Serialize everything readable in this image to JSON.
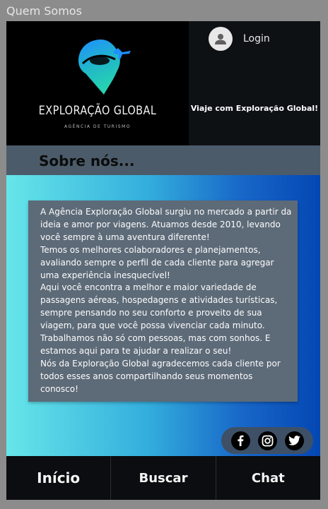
{
  "window": {
    "title": "Quem Somos"
  },
  "header": {
    "logo_title": "EXPLORAÇÃO GLOBAL",
    "logo_subtitle": "AGÊNCIA DE TURISMO",
    "login_label": "Login",
    "tagline": "Viaje com Exploração Global!"
  },
  "about": {
    "title": "Sobre nós...",
    "paragraphs": [
      "A Agência Exploração Global surgiu no mercado a partir da ideia e amor por viagens. Atuamos desde 2010, levando você sempre à uma aventura diferente!",
      "Temos os melhores colaboradores e planejamentos, avaliando sempre o perfil de cada cliente para agregar uma experiência inesquecível!",
      "Aqui você encontra a melhor e maior variedade de passagens aéreas, hospedagens e atividades turísticas, sempre pensando no seu conforto e proveito de sua viagem, para que você possa vivenciar cada minuto.",
      "Trabalhamos não só com pessoas, mas com sonhos. E estamos aqui para te ajudar a realizar o seu!",
      "Nós da Exploração Global agradecemos cada cliente por todos esses anos compartilhando seus momentos conosco!"
    ]
  },
  "social": {
    "icons": [
      "facebook-icon",
      "instagram-icon",
      "twitter-icon"
    ]
  },
  "nav": {
    "items": [
      "Início",
      "Buscar",
      "Chat"
    ]
  },
  "colors": {
    "header_bg": "#000000",
    "about_bar": "#4b5b69",
    "text_box": "#5d6a78",
    "gradient_start": "#66e6e9",
    "gradient_end": "#0447b3"
  }
}
